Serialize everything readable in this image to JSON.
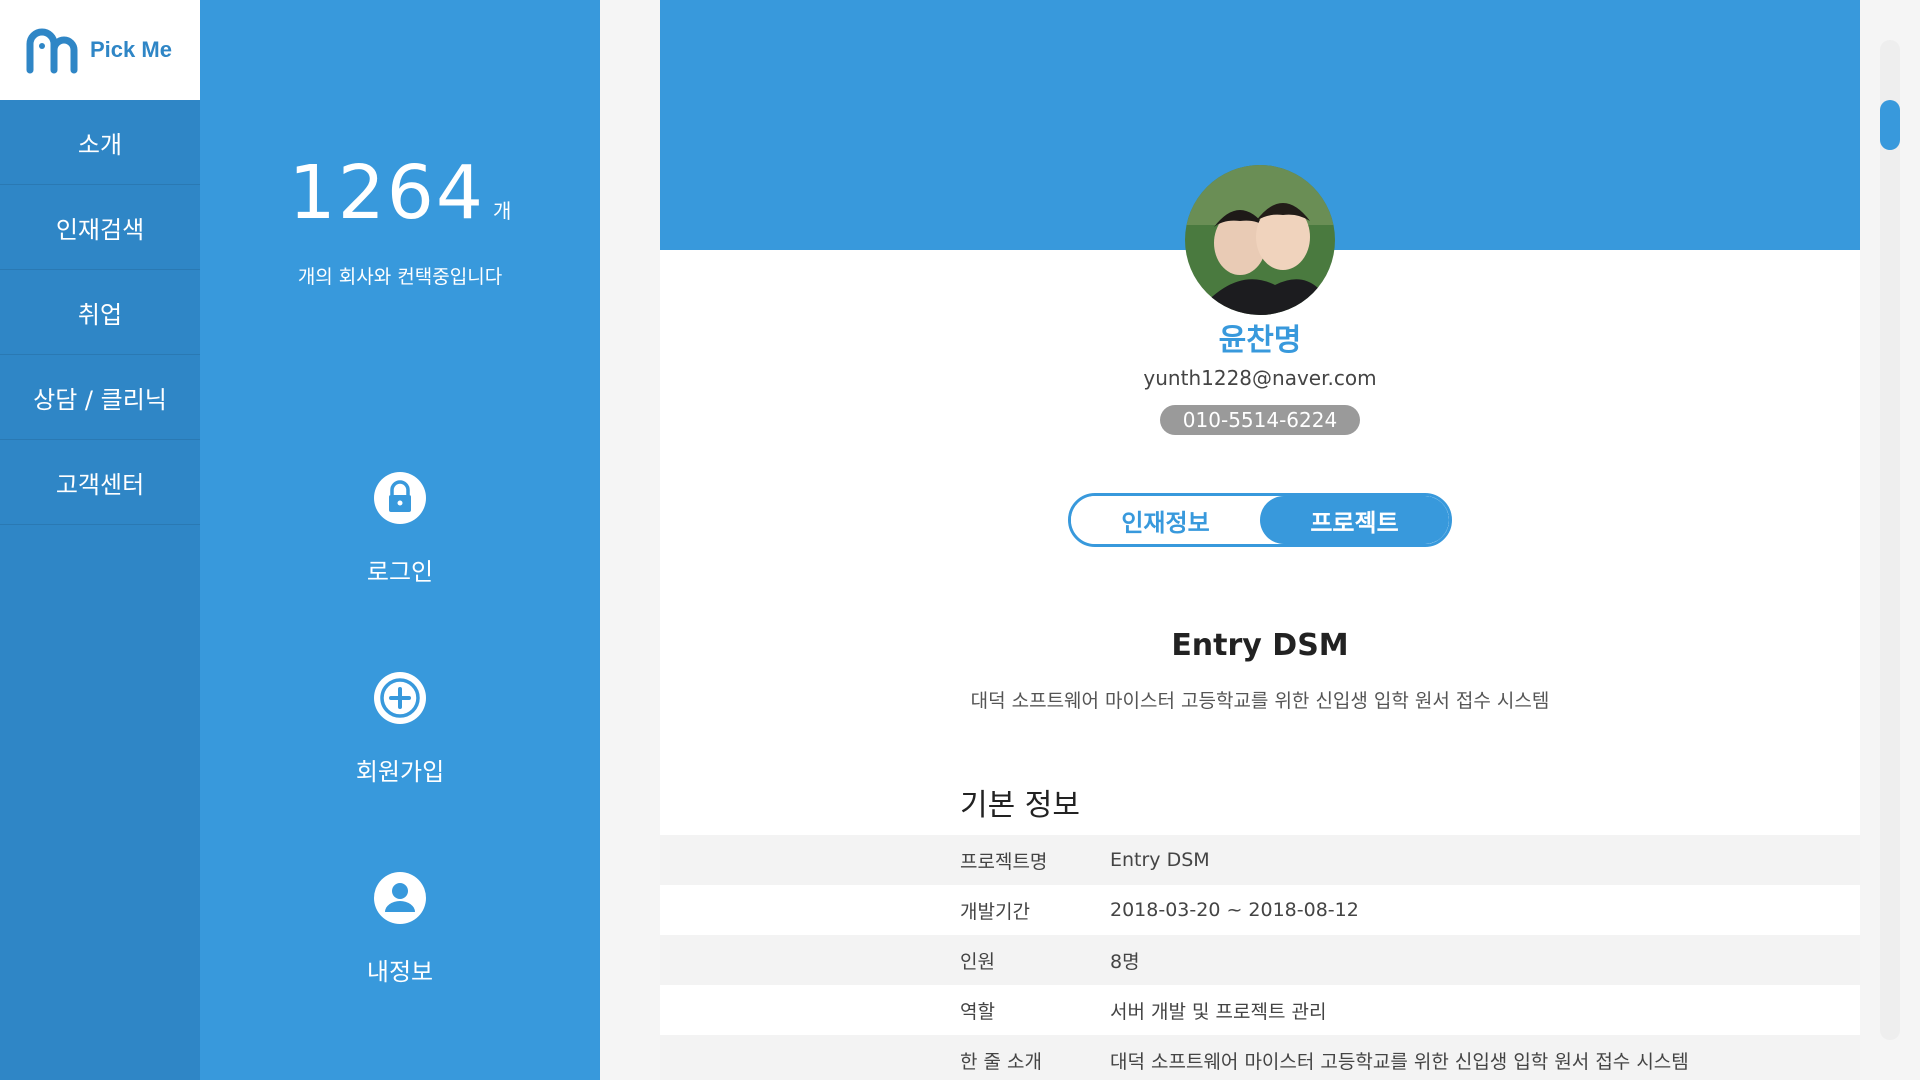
{
  "brand": {
    "name": "Pick Me",
    "color": "#2f86c6"
  },
  "nav": {
    "items": [
      {
        "label": "소개"
      },
      {
        "label": "인재검색"
      },
      {
        "label": "취업"
      },
      {
        "label": "상담 / 클리닉"
      },
      {
        "label": "고객센터"
      }
    ]
  },
  "panel": {
    "count": "1264",
    "unit": "개",
    "subtitle": "개의 회사와 컨택중입니다",
    "actions": [
      {
        "label": "로그인",
        "icon": "lock-icon"
      },
      {
        "label": "회원가입",
        "icon": "plus-circle-icon"
      },
      {
        "label": "내정보",
        "icon": "user-circle-icon"
      }
    ]
  },
  "profile": {
    "name": "윤찬명",
    "email": "yunth1228@naver.com",
    "phone": "010-5514-6224"
  },
  "tabs": [
    {
      "label": "인재정보",
      "active": false
    },
    {
      "label": "프로젝트",
      "active": true
    }
  ],
  "project": {
    "title": "Entry DSM",
    "description": "대덕 소프트웨어 마이스터 고등학교를 위한 신입생 입학 원서 접수 시스템",
    "section_title": "기본 정보",
    "rows": [
      {
        "key": "프로젝트명",
        "value": "Entry DSM"
      },
      {
        "key": "개발기간",
        "value": "2018-03-20 ~ 2018-08-12"
      },
      {
        "key": "인원",
        "value": "8명"
      },
      {
        "key": "역할",
        "value": "서버 개발 및 프로젝트 관리"
      },
      {
        "key": "한 줄 소개",
        "value": "대덕 소프트웨어 마이스터 고등학교를 위한 신입생 입학 원서 접수 시스템"
      }
    ]
  },
  "colors": {
    "accent": "#3899dc",
    "nav": "#2f86c6",
    "phone_badge": "#9a9a9a"
  }
}
